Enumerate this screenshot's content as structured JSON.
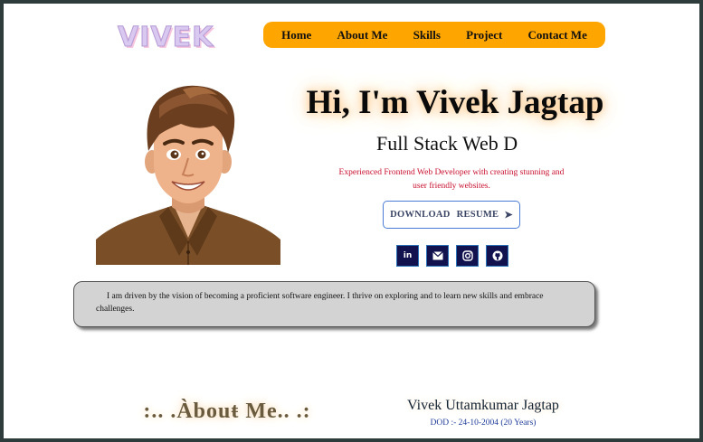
{
  "logo": {
    "text": "VIVEK"
  },
  "nav": {
    "items": [
      "Home",
      "About Me",
      "Skills",
      "Project",
      "Contact Me"
    ]
  },
  "hero": {
    "title": "Hi, I'm Vivek Jagtap",
    "subtitle": "Full Stack Web D",
    "description": "Experienced Frontend Web Developer with creating stunning and user friendly websites.",
    "resume_button": "DOWNLOAD  RESUME",
    "resume_arrow": "➤"
  },
  "socials": {
    "items": [
      "linkedin-icon",
      "email-icon",
      "instagram-icon",
      "github-icon"
    ],
    "linkedin_glyph": "in"
  },
  "about": {
    "text": "I am driven by the vision of becoming a proficient software engineer. I thrive on exploring and to learn new skills and embrace challenges.",
    "heading": ":.. .Àbouŧ Мe.. .:"
  },
  "profile": {
    "name": "Vivek Uttamkumar Jagtap",
    "dob": "DOD :- 24-10-2004 (20 Years)"
  },
  "colors": {
    "nav_bg": "#ffa500",
    "social_bg": "#12124f",
    "desc_text": "#c8102e",
    "about_box_bg": "#d3d3d4",
    "frame": "#2e3d3b"
  }
}
